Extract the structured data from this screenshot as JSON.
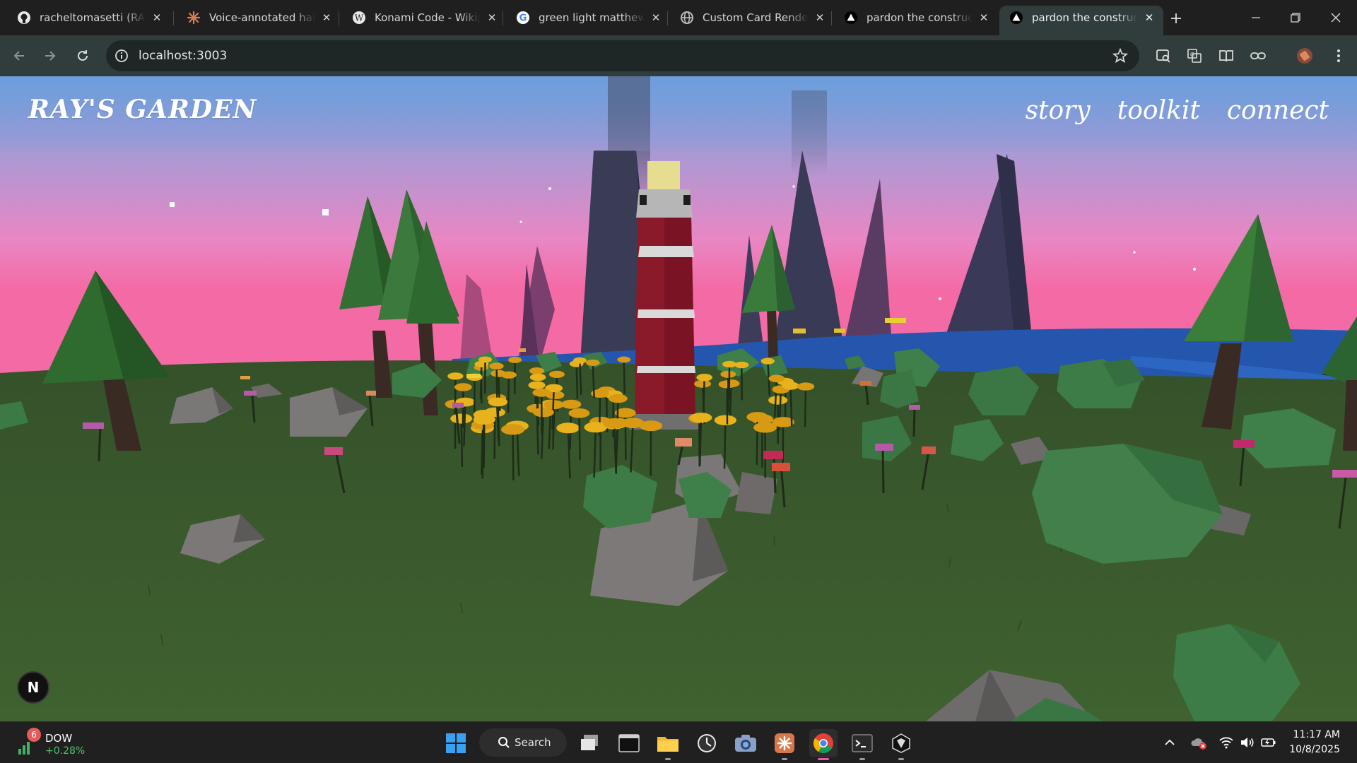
{
  "browser": {
    "tabs": [
      {
        "title": "racheltomasetti (RAY)",
        "icon": "github-icon",
        "active": false
      },
      {
        "title": "Voice-annotated habi",
        "icon": "claude-icon",
        "active": false
      },
      {
        "title": "Konami Code - Wikip",
        "icon": "wikipedia-icon",
        "active": false
      },
      {
        "title": "green light matthew",
        "icon": "google-icon",
        "active": false
      },
      {
        "title": "Custom Card Renderi",
        "icon": "globe-icon",
        "active": false
      },
      {
        "title": "pardon the constructi",
        "icon": "vercel-icon",
        "active": false
      },
      {
        "title": "pardon the constructi",
        "icon": "vercel-icon",
        "active": true
      }
    ],
    "url": "localhost:3003"
  },
  "site": {
    "logo": "RAY'S GARDEN",
    "nav": [
      "story",
      "toolkit",
      "connect"
    ],
    "badge": "N"
  },
  "taskbar": {
    "stock": {
      "name": "DOW",
      "change": "+0.28%",
      "count": "6"
    },
    "search_label": "Search",
    "time": "11:17 AM",
    "date": "10/8/2025"
  },
  "colors": {
    "sky_top": "#6b9fe0",
    "sky_bottom": "#f06aa8",
    "grass": "#3f5e2e",
    "lighthouse_red": "#8a1a2a",
    "water": "#2a5fb0",
    "taskbar_accent": "#e95aa8"
  }
}
